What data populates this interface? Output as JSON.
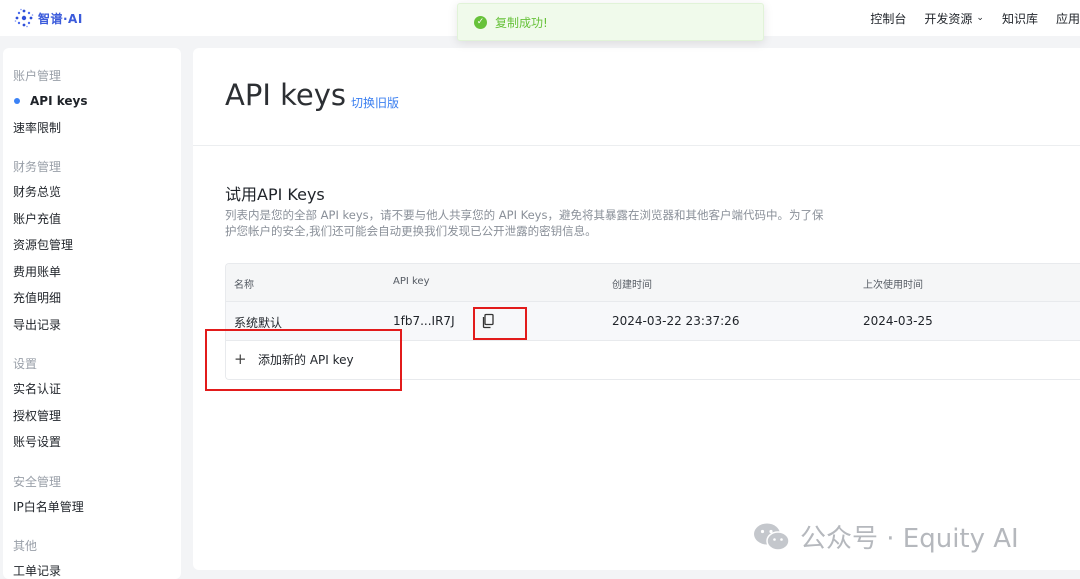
{
  "brand": {
    "name": "智谱·AI"
  },
  "nav": {
    "items": [
      {
        "label": "控制台"
      },
      {
        "label": "开发资源",
        "dropdown": true
      },
      {
        "label": "知识库"
      },
      {
        "label": "应用"
      }
    ]
  },
  "toast": {
    "message": "复制成功!",
    "color": "#67c23a"
  },
  "sidebar": {
    "groups": [
      {
        "title": "账户管理",
        "items": [
          {
            "label": "API keys",
            "active": true
          },
          {
            "label": "速率限制"
          }
        ]
      },
      {
        "title": "财务管理",
        "items": [
          {
            "label": "财务总览"
          },
          {
            "label": "账户充值"
          },
          {
            "label": "资源包管理"
          },
          {
            "label": "费用账单"
          },
          {
            "label": "充值明细"
          },
          {
            "label": "导出记录"
          }
        ]
      },
      {
        "title": "设置",
        "items": [
          {
            "label": "实名认证"
          },
          {
            "label": "授权管理"
          },
          {
            "label": "账号设置"
          }
        ]
      },
      {
        "title": "安全管理",
        "items": [
          {
            "label": "IP白名单管理"
          }
        ]
      },
      {
        "title": "其他",
        "items": [
          {
            "label": "工单记录"
          }
        ]
      }
    ]
  },
  "page": {
    "title": "API keys",
    "switch_link": "切换旧版",
    "section_title": "试用API Keys",
    "section_desc": "列表内是您的全部 API keys，请不要与他人共享您的 API Keys，避免将其暴露在浏览器和其他客户端代码中。为了保护您帐户的安全,我们还可能会自动更换我们发现已公开泄露的密钥信息。"
  },
  "table": {
    "columns": [
      "名称",
      "API key",
      "创建时间",
      "上次使用时间"
    ],
    "rows": [
      {
        "name": "系统默认",
        "key": "1fb7...IR7J",
        "created": "2024-03-22 23:37:26",
        "last_used": "2024-03-25"
      }
    ],
    "add_label": "添加新的 API key"
  },
  "watermark": {
    "text": "公众号 · Equity AI"
  },
  "colors": {
    "accent": "#3b82f6",
    "highlight": "#e21b1b",
    "link": "#3b7ff0"
  }
}
